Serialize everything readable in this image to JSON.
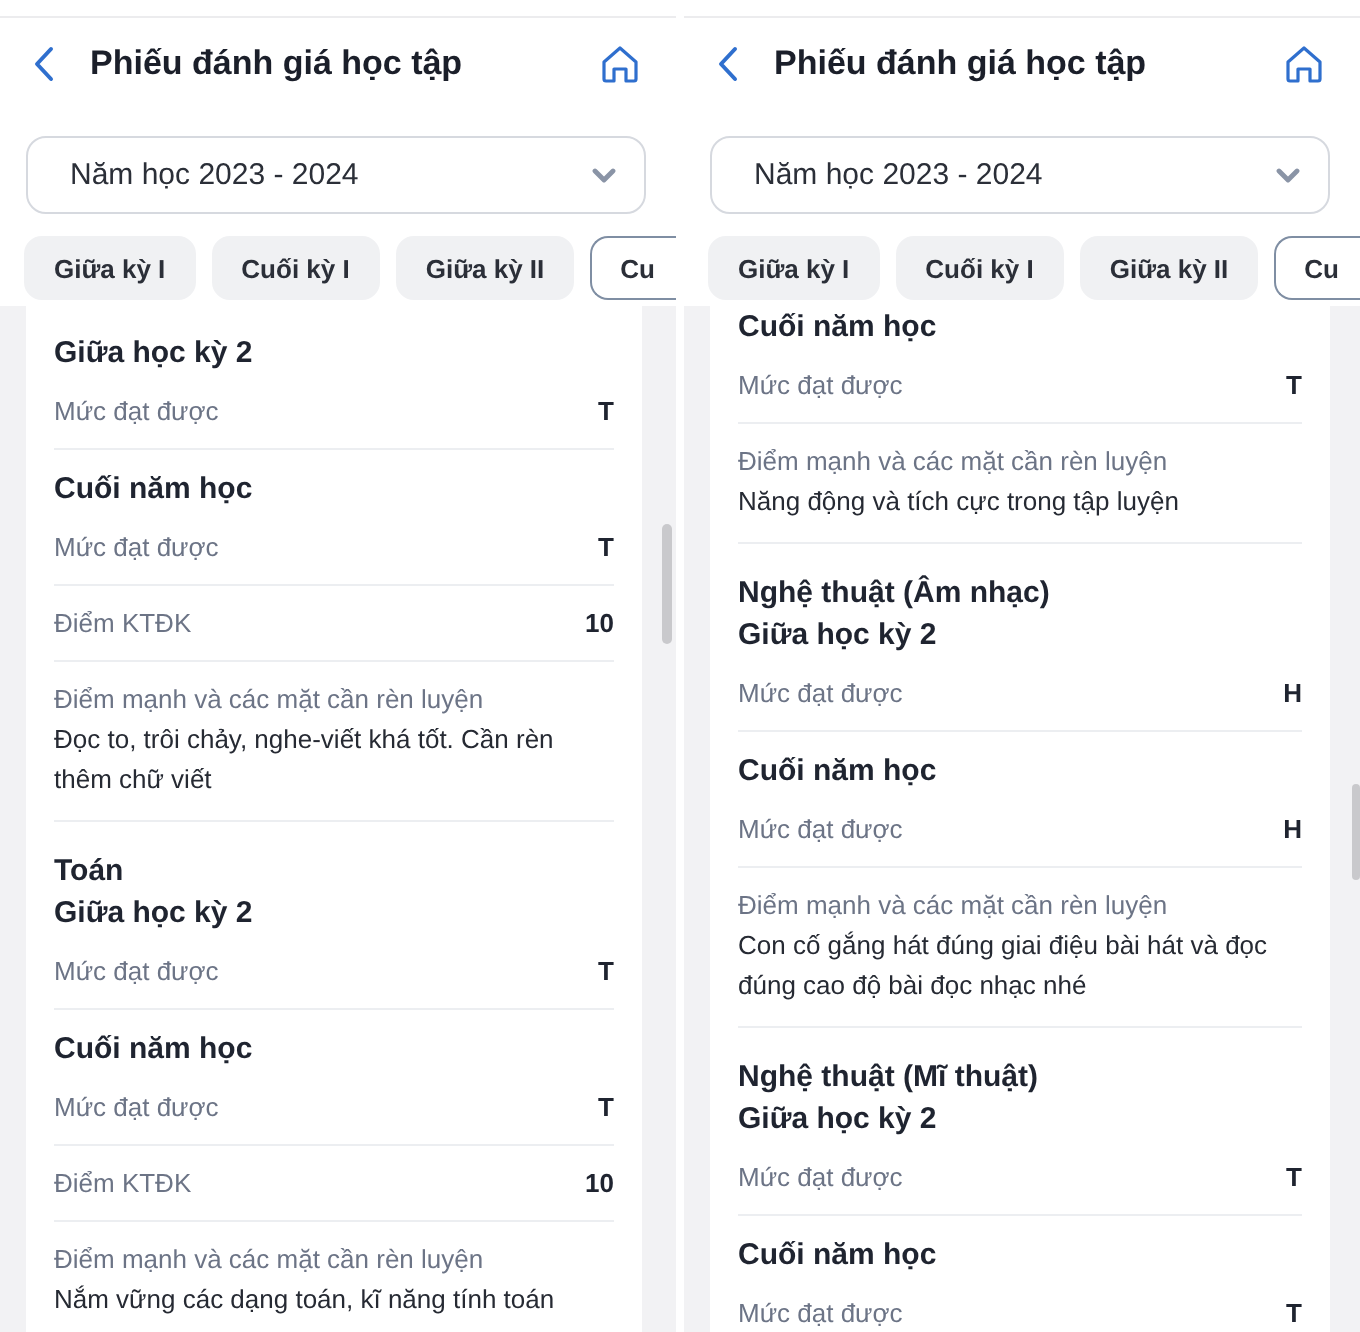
{
  "screens": [
    {
      "header": {
        "title": "Phiếu đánh giá học tập"
      },
      "year_select": {
        "value": "Năm học 2023 - 2024"
      },
      "tabs": [
        {
          "label": "Giữa kỳ I",
          "selected": false
        },
        {
          "label": "Cuối kỳ I",
          "selected": false
        },
        {
          "label": "Giữa kỳ II",
          "selected": false
        },
        {
          "label": "Cu",
          "selected": true
        }
      ],
      "subjects": [
        {
          "periods": [
            {
              "title": "Giữa học kỳ 2",
              "entries": [
                {
                  "kind": "grade",
                  "label": "Mức đạt được",
                  "value": "T"
                }
              ]
            },
            {
              "title": "Cuối năm học",
              "entries": [
                {
                  "kind": "grade",
                  "label": "Mức đạt được",
                  "value": "T"
                },
                {
                  "kind": "grade",
                  "label": "Điểm KTĐK",
                  "value": "10"
                },
                {
                  "kind": "comment",
                  "label": "Điểm mạnh và các mặt cần rèn luyện",
                  "text": "Đọc to, trôi chảy, nghe-viết khá tốt. Cần rèn thêm chữ viết"
                }
              ]
            }
          ]
        },
        {
          "name": "Toán",
          "periods": [
            {
              "title": "Giữa học kỳ 2",
              "entries": [
                {
                  "kind": "grade",
                  "label": "Mức đạt được",
                  "value": "T"
                }
              ]
            },
            {
              "title": "Cuối năm học",
              "entries": [
                {
                  "kind": "grade",
                  "label": "Mức đạt được",
                  "value": "T"
                },
                {
                  "kind": "grade",
                  "label": "Điểm KTĐK",
                  "value": "10"
                },
                {
                  "kind": "comment",
                  "label": "Điểm mạnh và các mặt cần rèn luyện",
                  "text": "Nắm vững các dạng toán, kĩ năng tính toán"
                }
              ]
            }
          ]
        }
      ]
    },
    {
      "header": {
        "title": "Phiếu đánh giá học tập"
      },
      "year_select": {
        "value": "Năm học 2023 - 2024"
      },
      "tabs": [
        {
          "label": "Giữa kỳ I",
          "selected": false
        },
        {
          "label": "Cuối kỳ I",
          "selected": false
        },
        {
          "label": "Giữa kỳ II",
          "selected": false
        },
        {
          "label": "Cu",
          "selected": true
        }
      ],
      "subjects": [
        {
          "periods": [
            {
              "title": "Cuối năm học",
              "entries": [
                {
                  "kind": "grade",
                  "label": "Mức đạt được",
                  "value": "T"
                },
                {
                  "kind": "comment",
                  "label": "Điểm mạnh và các mặt cần rèn luyện",
                  "text": "Năng động và tích cực trong tập luyện"
                }
              ]
            }
          ]
        },
        {
          "name": "Nghệ thuật (Âm nhạc)",
          "periods": [
            {
              "title": "Giữa học kỳ 2",
              "entries": [
                {
                  "kind": "grade",
                  "label": "Mức đạt được",
                  "value": "H"
                }
              ]
            },
            {
              "title": "Cuối năm học",
              "entries": [
                {
                  "kind": "grade",
                  "label": "Mức đạt được",
                  "value": "H"
                },
                {
                  "kind": "comment",
                  "label": "Điểm mạnh và các mặt cần rèn luyện",
                  "text": "Con cố gắng hát đúng giai điệu bài hát và đọc đúng cao độ bài đọc nhạc nhé"
                }
              ]
            }
          ]
        },
        {
          "name": "Nghệ thuật (Mĩ thuật)",
          "periods": [
            {
              "title": "Giữa học kỳ 2",
              "entries": [
                {
                  "kind": "grade",
                  "label": "Mức đạt được",
                  "value": "T"
                }
              ]
            },
            {
              "title": "Cuối năm học",
              "entries": [
                {
                  "kind": "grade",
                  "label": "Mức đạt được",
                  "value": "T"
                }
              ]
            }
          ]
        }
      ]
    }
  ]
}
